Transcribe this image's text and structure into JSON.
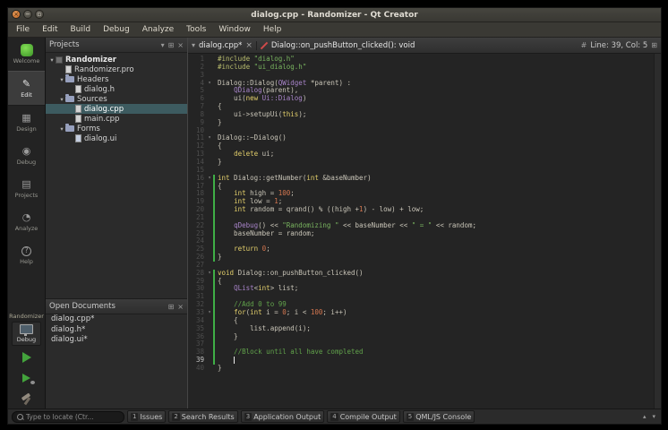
{
  "window": {
    "title": "dialog.cpp - Randomizer - Qt Creator"
  },
  "menubar": {
    "items": [
      "File",
      "Edit",
      "Build",
      "Debug",
      "Analyze",
      "Tools",
      "Window",
      "Help"
    ]
  },
  "modebar": {
    "items": [
      {
        "id": "welcome",
        "label": "Welcome"
      },
      {
        "id": "edit",
        "label": "Edit",
        "active": true
      },
      {
        "id": "design",
        "label": "Design"
      },
      {
        "id": "debug",
        "label": "Debug"
      },
      {
        "id": "projects",
        "label": "Projects"
      },
      {
        "id": "analyze",
        "label": "Analyze"
      },
      {
        "id": "help",
        "label": "Help"
      }
    ],
    "kit_project": "Randomizer",
    "kit_config": "Debug"
  },
  "projects": {
    "title": "Projects",
    "tree": [
      {
        "label": "Randomizer",
        "depth": 0,
        "icon": "project",
        "expand": true,
        "bold": true
      },
      {
        "label": "Randomizer.pro",
        "depth": 1,
        "icon": "file-pro"
      },
      {
        "label": "Headers",
        "depth": 1,
        "icon": "folder",
        "expand": true
      },
      {
        "label": "dialog.h",
        "depth": 2,
        "icon": "file-h"
      },
      {
        "label": "Sources",
        "depth": 1,
        "icon": "folder",
        "expand": true
      },
      {
        "label": "dialog.cpp",
        "depth": 2,
        "icon": "file-cpp",
        "selected": true
      },
      {
        "label": "main.cpp",
        "depth": 2,
        "icon": "file-cpp"
      },
      {
        "label": "Forms",
        "depth": 1,
        "icon": "folder",
        "expand": true
      },
      {
        "label": "dialog.ui",
        "depth": 2,
        "icon": "file-ui"
      }
    ]
  },
  "open_documents": {
    "title": "Open Documents",
    "items": [
      "dialog.cpp*",
      "dialog.h*",
      "dialog.ui*"
    ]
  },
  "editor": {
    "tab": {
      "file": "dialog.cpp*",
      "symbol": "Dialog::on_pushButton_clicked(): void",
      "position": "Line: 39, Col: 5"
    },
    "cursor_line": 39,
    "fold_lines": [
      4,
      11,
      16,
      28,
      33
    ],
    "changed_ranges": [
      [
        16,
        26
      ],
      [
        28,
        39
      ]
    ],
    "lines": [
      {
        "t": [
          [
            "pre",
            "#include "
          ],
          [
            "str",
            "\"dialog.h\""
          ]
        ]
      },
      {
        "t": [
          [
            "pre",
            "#include "
          ],
          [
            "str",
            "\"ui_dialog.h\""
          ]
        ]
      },
      {
        "t": []
      },
      {
        "t": [
          [
            "pln",
            "Dialog::Dialog("
          ],
          [
            "typ",
            "QWidget"
          ],
          [
            "pln",
            " *parent) :"
          ]
        ]
      },
      {
        "t": [
          [
            "pln",
            "    "
          ],
          [
            "typ",
            "QDialog"
          ],
          [
            "pln",
            "(parent),"
          ]
        ]
      },
      {
        "t": [
          [
            "pln",
            "    ui("
          ],
          [
            "kw",
            "new"
          ],
          [
            "pln",
            " "
          ],
          [
            "typ",
            "Ui::Dialog"
          ],
          [
            "pln",
            ")"
          ]
        ]
      },
      {
        "t": [
          [
            "pln",
            "{"
          ]
        ]
      },
      {
        "t": [
          [
            "pln",
            "    ui->setupUi("
          ],
          [
            "kw",
            "this"
          ],
          [
            "pln",
            ");"
          ]
        ]
      },
      {
        "t": [
          [
            "pln",
            "}"
          ]
        ]
      },
      {
        "t": []
      },
      {
        "t": [
          [
            "pln",
            "Dialog::~Dialog()"
          ]
        ]
      },
      {
        "t": [
          [
            "pln",
            "{"
          ]
        ]
      },
      {
        "t": [
          [
            "pln",
            "    "
          ],
          [
            "kw",
            "delete"
          ],
          [
            "pln",
            " ui;"
          ]
        ]
      },
      {
        "t": [
          [
            "pln",
            "}"
          ]
        ]
      },
      {
        "t": []
      },
      {
        "t": [
          [
            "kw",
            "int"
          ],
          [
            "pln",
            " Dialog::getNumber("
          ],
          [
            "kw",
            "int"
          ],
          [
            "pln",
            " &baseNumber)"
          ]
        ]
      },
      {
        "t": [
          [
            "pln",
            "{"
          ]
        ]
      },
      {
        "t": [
          [
            "pln",
            "    "
          ],
          [
            "kw",
            "int"
          ],
          [
            "pln",
            " high = "
          ],
          [
            "num",
            "100"
          ],
          [
            "pln",
            ";"
          ]
        ]
      },
      {
        "t": [
          [
            "pln",
            "    "
          ],
          [
            "kw",
            "int"
          ],
          [
            "pln",
            " low = "
          ],
          [
            "num",
            "1"
          ],
          [
            "pln",
            ";"
          ]
        ]
      },
      {
        "t": [
          [
            "pln",
            "    "
          ],
          [
            "kw",
            "int"
          ],
          [
            "pln",
            " random = qrand() % ((high +"
          ],
          [
            "num",
            "1"
          ],
          [
            "pln",
            ") - low) + low;"
          ]
        ]
      },
      {
        "t": []
      },
      {
        "t": [
          [
            "pln",
            "    "
          ],
          [
            "typ",
            "qDebug"
          ],
          [
            "pln",
            "() << "
          ],
          [
            "str",
            "\"Randomizing \""
          ],
          [
            "pln",
            " << baseNumber << "
          ],
          [
            "str",
            "\" = \""
          ],
          [
            "pln",
            " << random;"
          ]
        ]
      },
      {
        "t": [
          [
            "pln",
            "    baseNumber = random;"
          ]
        ]
      },
      {
        "t": []
      },
      {
        "t": [
          [
            "pln",
            "    "
          ],
          [
            "kw",
            "return"
          ],
          [
            "pln",
            " "
          ],
          [
            "num",
            "0"
          ],
          [
            "pln",
            ";"
          ]
        ]
      },
      {
        "t": [
          [
            "pln",
            "}"
          ]
        ]
      },
      {
        "t": []
      },
      {
        "t": [
          [
            "kw",
            "void"
          ],
          [
            "pln",
            " Dialog::on_pushButton_clicked()"
          ]
        ]
      },
      {
        "t": [
          [
            "pln",
            "{"
          ]
        ]
      },
      {
        "t": [
          [
            "pln",
            "    "
          ],
          [
            "typ",
            "QList"
          ],
          [
            "pln",
            "<"
          ],
          [
            "kw",
            "int"
          ],
          [
            "pln",
            "> list;"
          ]
        ]
      },
      {
        "t": []
      },
      {
        "t": [
          [
            "pln",
            "    "
          ],
          [
            "com",
            "//Add 0 to 99"
          ]
        ]
      },
      {
        "t": [
          [
            "pln",
            "    "
          ],
          [
            "kw",
            "for"
          ],
          [
            "pln",
            "("
          ],
          [
            "kw",
            "int"
          ],
          [
            "pln",
            " i = "
          ],
          [
            "num",
            "0"
          ],
          [
            "pln",
            "; i < "
          ],
          [
            "num",
            "100"
          ],
          [
            "pln",
            "; i++)"
          ]
        ]
      },
      {
        "t": [
          [
            "pln",
            "    {"
          ]
        ]
      },
      {
        "t": [
          [
            "pln",
            "        list.append(i);"
          ]
        ]
      },
      {
        "t": [
          [
            "pln",
            "    }"
          ]
        ]
      },
      {
        "t": []
      },
      {
        "t": [
          [
            "pln",
            "    "
          ],
          [
            "com",
            "//Block until all have completed"
          ]
        ]
      },
      {
        "t": [
          [
            "pln",
            "    "
          ]
        ]
      },
      {
        "t": [
          [
            "pln",
            "}"
          ]
        ]
      }
    ]
  },
  "statusbar": {
    "locate_placeholder": "Type to locate (Ctr...",
    "buttons": [
      {
        "num": "1",
        "label": "Issues"
      },
      {
        "num": "2",
        "label": "Search Results"
      },
      {
        "num": "3",
        "label": "Application Output"
      },
      {
        "num": "4",
        "label": "Compile Output"
      },
      {
        "num": "5",
        "label": "QML/JS Console"
      }
    ]
  },
  "colors": {
    "run_button_green": "#43a33c",
    "change_bar_green": "#3fae46",
    "tree_selection_teal": "#3d5b60",
    "close_button_orange": "#d8803c"
  }
}
